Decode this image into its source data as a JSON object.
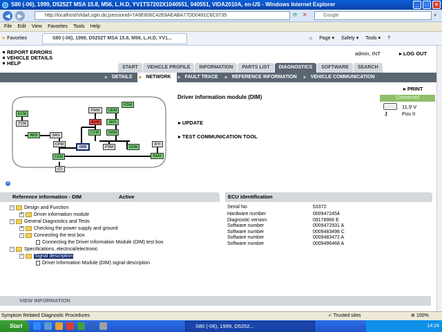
{
  "window": {
    "title": "S80 (-06), 1999, D5252T MSA 15.8, M56, L.H.D, YV1TS7202X1040551, 040551, VIDA2010A, en-US - Windows Internet Explorer"
  },
  "browser": {
    "url": "http://localhost/Vida/Login.do;jsessionid=7A6E806C42E8AEABA77DD0491C6C0735",
    "search_placeholder": "Google",
    "menu": [
      "File",
      "Edit",
      "View",
      "Favorites",
      "Tools",
      "Help"
    ],
    "favorites_label": "Favorites",
    "tab_title": "S80 (-06), 1999, D5252T MSA 15.8, M56, L.H.D, YV1...",
    "tools": [
      "Page ▾",
      "Safety ▾",
      "Tools ▾",
      "?"
    ]
  },
  "header": {
    "links": [
      "REPORT ERRORS",
      "VEHICLE DETAILS",
      "HELP"
    ],
    "user": "admin, INT",
    "logout": "LOG OUT"
  },
  "tabs": [
    "START",
    "VEHICLE PROFILE",
    "INFORMATION",
    "PARTS LIST",
    "DIAGNOSTICS",
    "SOFTWARE",
    "SEARCH"
  ],
  "active_tab": "DIAGNOSTICS",
  "subtabs": [
    "DETAILS",
    "NETWORK",
    "FAULT TRACE",
    "REFERENCE INFORMATION",
    "VEHICLE COMMUNICATION"
  ],
  "active_subtab": "NETWORK",
  "network": {
    "modules": [
      {
        "name": "ECM",
        "status": "green"
      },
      {
        "name": "TCM",
        "status": "grey"
      },
      {
        "name": "ABS",
        "status": "green"
      },
      {
        "name": "SAS",
        "status": "grey"
      },
      {
        "name": "CPM",
        "status": "grey"
      },
      {
        "name": "CEM",
        "status": "green"
      },
      {
        "name": "CT",
        "status": "grey"
      },
      {
        "name": "PHM",
        "status": "grey"
      },
      {
        "name": "UEM",
        "status": "green"
      },
      {
        "name": "PDM",
        "status": "green"
      },
      {
        "name": "AUM",
        "status": "red"
      },
      {
        "name": "SRS",
        "status": "green"
      },
      {
        "name": "CCM",
        "status": "green"
      },
      {
        "name": "SWM",
        "status": "green"
      },
      {
        "name": "DIM",
        "status": "selected"
      },
      {
        "name": "PSM",
        "status": "grey"
      },
      {
        "name": "DDM",
        "status": "green"
      },
      {
        "name": "RTI",
        "status": "grey"
      },
      {
        "name": "REM",
        "status": "green"
      }
    ]
  },
  "module_panel": {
    "title": "Driver information module (DIM)",
    "actions": [
      "UPDATE",
      "TEST COMMUNICATION TOOL"
    ],
    "print": "PRINT",
    "connection": "Connected",
    "voltage": "11,9 V",
    "position": "Pos II"
  },
  "reference": {
    "title": "Reference information - DIM",
    "status": "Active",
    "tree": [
      {
        "label": "Design and Function",
        "level": 0,
        "type": "folder",
        "expander": "-"
      },
      {
        "label": "Driver information module",
        "level": 1,
        "type": "folder",
        "expander": "+"
      },
      {
        "label": "General Diagnostics and Tests",
        "level": 0,
        "type": "folder",
        "expander": "-"
      },
      {
        "label": "Checking the power supply and ground",
        "level": 1,
        "type": "folder",
        "expander": "+"
      },
      {
        "label": "Connecting the test box",
        "level": 1,
        "type": "folder",
        "expander": "-"
      },
      {
        "label": "Connecting the Driver Information Module (DIM) test box",
        "level": 2,
        "type": "doc",
        "expander": ""
      },
      {
        "label": "Specifications, electrical/electronic",
        "level": 0,
        "type": "folder",
        "expander": "-"
      },
      {
        "label": "Signal description",
        "level": 1,
        "type": "folder",
        "expander": "-",
        "selected": true
      },
      {
        "label": "Driver Information Module (DIM) signal description",
        "level": 2,
        "type": "doc",
        "expander": ""
      }
    ]
  },
  "ecu": {
    "title": "ECU identification",
    "rows": [
      {
        "key": "Serial No",
        "value": "53372"
      },
      {
        "key": "Hardware number",
        "value": "0009472454"
      },
      {
        "key": "Diagnostic version",
        "value": "09178966  E"
      },
      {
        "key": "Software number",
        "value": "0009472931  A"
      },
      {
        "key": "Software number",
        "value": "0009483498  C"
      },
      {
        "key": "Software number",
        "value": "0009483472  A"
      },
      {
        "key": "Software number",
        "value": "0009496468  A"
      }
    ]
  },
  "view_information": "VIEW INFORMATION",
  "statusbar": {
    "left": "Symptom Related Diagnostic Procedures",
    "middle": "Trusted sites",
    "zoom": "100%"
  },
  "taskbar": {
    "start": "Start",
    "task": "S80 (-06), 1999, D5252...",
    "time": "14:24"
  },
  "colors": {
    "accent": "#5a6672",
    "green": "#7ad07a",
    "red": "#e84040",
    "connected": "#8fbf6a"
  }
}
